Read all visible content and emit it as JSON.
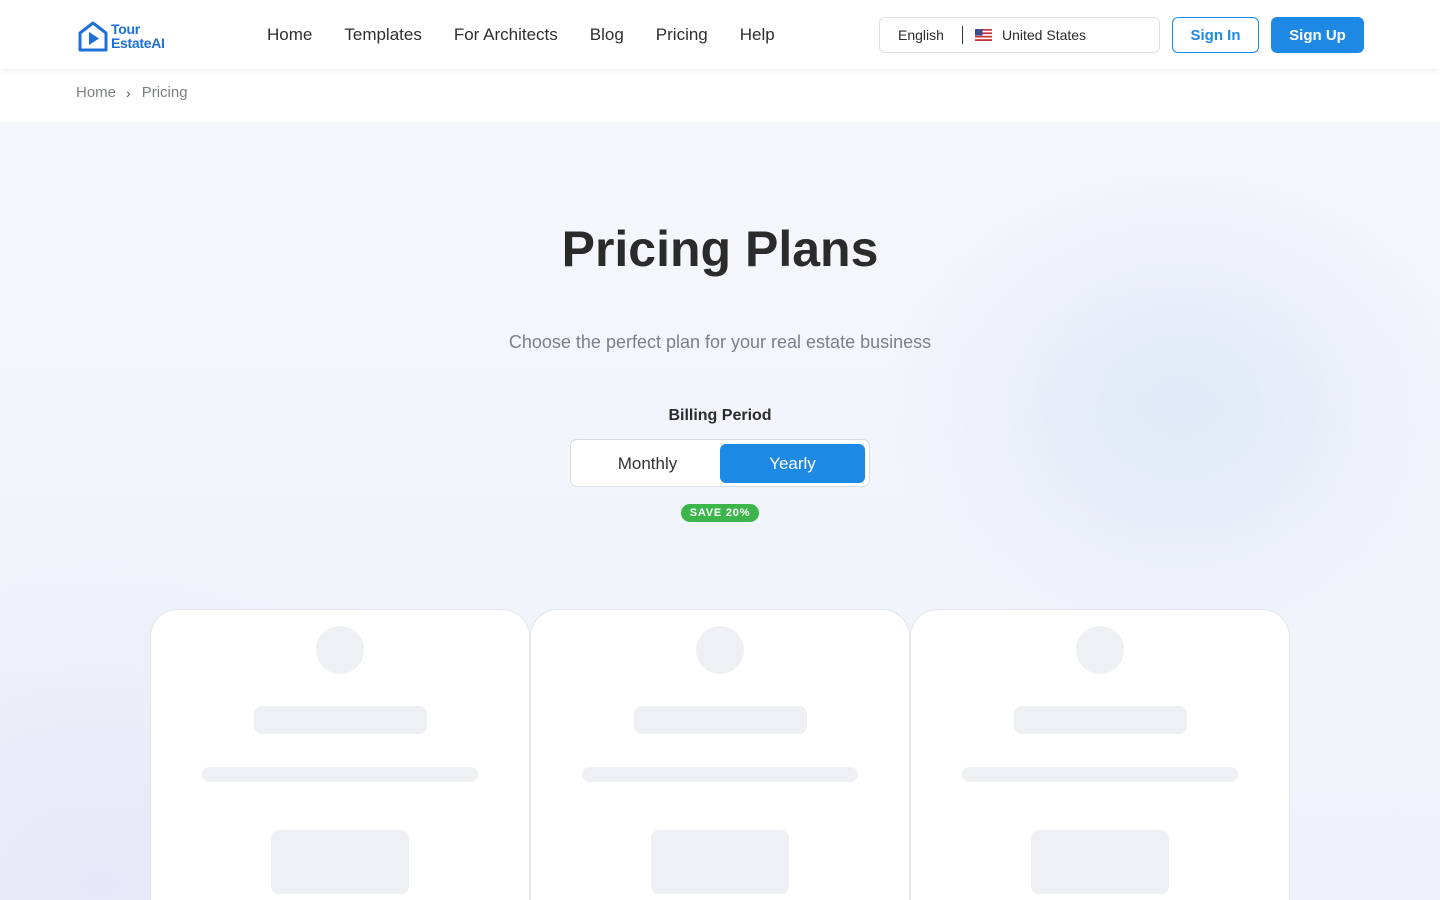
{
  "brand": {
    "line1": "Tour",
    "line2": "EstateAI",
    "color": "#1e6fd9"
  },
  "nav": {
    "items": [
      "Home",
      "Templates",
      "For Architects",
      "Blog",
      "Pricing",
      "Help"
    ]
  },
  "locale": {
    "language": "English",
    "flag_icon": "us-flag-icon",
    "country": "United States"
  },
  "auth": {
    "sign_in": "Sign In",
    "sign_up": "Sign Up",
    "accent_color": "#1e88e5"
  },
  "breadcrumb": {
    "home": "Home",
    "current": "Pricing"
  },
  "hero": {
    "title": "Pricing Plans",
    "subtitle": "Choose the perfect plan for your real estate business"
  },
  "billing": {
    "label": "Billing Period",
    "options": [
      "Monthly",
      "Yearly"
    ],
    "selected": "Yearly",
    "save_badge": "SAVE 20%",
    "badge_color": "#3cb54a"
  },
  "plans": {
    "state": "loading",
    "count": 3
  }
}
